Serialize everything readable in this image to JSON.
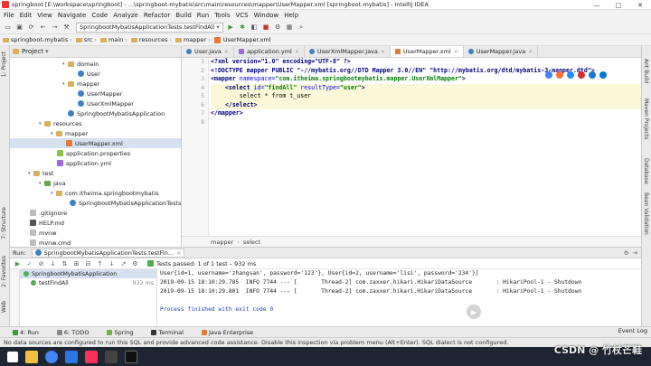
{
  "window": {
    "title": "springboot [E:\\workspace\\springboot] - ...\\springboot-mybatis\\src\\main\\resources\\mapper\\UserMapper.xml [springboot-mybatis] - IntelliJ IDEA",
    "controls": [
      "—",
      "□",
      "✕"
    ]
  },
  "menu": [
    "File",
    "Edit",
    "View",
    "Navigate",
    "Code",
    "Analyze",
    "Refactor",
    "Build",
    "Run",
    "Tools",
    "VCS",
    "Window",
    "Help"
  ],
  "toolbar": {
    "run_config": "SpringbootMybatisApplicationTests.testFindAll"
  },
  "breadcrumbs": [
    "springboot-mybatis",
    "src",
    "main",
    "resources",
    "mapper",
    "UserMapper.xml"
  ],
  "left_strip": [
    "1: Project",
    "7: Structure",
    "2: Favorites",
    "Web"
  ],
  "right_strip": [
    "Ant Build",
    "Maven Projects",
    "Database",
    "Bean Validation"
  ],
  "project_panel": {
    "title": "Project",
    "items": [
      {
        "label": "domain",
        "icon": "folder"
      },
      {
        "label": "User",
        "icon": "class"
      },
      {
        "label": "mapper",
        "icon": "folder"
      },
      {
        "label": "UserMapper",
        "icon": "class"
      },
      {
        "label": "UserXmlMapper",
        "icon": "class"
      },
      {
        "label": "SpringbootMybatisApplication",
        "icon": "class"
      },
      {
        "label": "resources",
        "icon": "folder"
      },
      {
        "label": "mapper",
        "icon": "folder"
      },
      {
        "label": "UserMapper.xml",
        "icon": "xml"
      },
      {
        "label": "application.properties",
        "icon": "props"
      },
      {
        "label": "application.yml",
        "icon": "yml"
      },
      {
        "label": "test",
        "icon": "folder"
      },
      {
        "label": "java",
        "icon": "greenfolder"
      },
      {
        "label": "com.itheima.springbootmybatis",
        "icon": "folder"
      },
      {
        "label": "SpringbootMybatisApplicationTests",
        "icon": "class"
      },
      {
        "label": ".gitignore",
        "icon": "file"
      },
      {
        "label": "HELP.md",
        "icon": "md"
      },
      {
        "label": "mvnw",
        "icon": "file"
      },
      {
        "label": "mvnw.cmd",
        "icon": "file"
      }
    ]
  },
  "editor": {
    "tabs": [
      "User.java",
      "application.yml",
      "UserXmlMapper.java",
      "UserMapper.xml",
      "UserMapper.java"
    ],
    "active_tab": "UserMapper.xml",
    "line_numbers": [
      "1",
      "2",
      "3",
      "4",
      "5",
      "6",
      "7",
      "8"
    ],
    "code": {
      "l1_a": "<?xml version=\"1.0\" encoding=\"UTF-8\" ?>",
      "l2_a": "<!DOCTYPE mapper PUBLIC \"-//mybatis.org//DTD Mapper 3.0//EN\" \"http://mybatis.org/dtd/mybatis-3-mapper.dtd\">",
      "l3_tag": "<mapper ",
      "l3_attr": "namespace=",
      "l3_str": "\"com.itheima.springbootmybatis.mapper.UserXmlMapper\"",
      "l3_end": ">",
      "l4_tag": "    <select ",
      "l4_attr1": "id=",
      "l4_str1": "\"findAll\"",
      "l4_attr2": " resultType=",
      "l4_str2": "\"user\"",
      "l4_end": ">",
      "l5": "        select * from t_user",
      "l6": "    </select>",
      "l7": "</mapper>"
    },
    "crumbs": [
      "mapper",
      "select"
    ]
  },
  "run_panel": {
    "label": "Run:",
    "tab": "SpringbootMybatisApplicationTests.testFin...",
    "status": "Tests passed: 1 of 1 test – 932 ms",
    "tests": [
      {
        "name": "SpringbootMybatisApplication",
        "time": ""
      },
      {
        "name": "testFindAll",
        "time": "932 ms"
      }
    ],
    "console": [
      "User{id=1, username='zhangsan', password='123'}, User{id=2, username='lisi', password='234'}]",
      "2019-09-15 18:10:29.785  INFO 7744 --- [       Thread-2] com.zaxxer.hikari.HikariDataSource       : HikariPool-1 - Shutdown",
      "2019-09-15 18:10:29.801  INFO 7744 --- [       Thread-2] com.zaxxer.hikari.HikariDataSource       : HikariPool-1 - Shutdown",
      "",
      "Process finished with exit code 0"
    ]
  },
  "bottom_tabs": [
    "4: Run",
    "6: TODO",
    "Spring",
    "Terminal",
    "Java Enterprise"
  ],
  "event_log": "Event Log",
  "statusbar": "No data sources are configured to run this SQL and provide advanced code assistance. Disable this inspection via problem menu (Alt+Enter). SQL dialect is not configured.",
  "watermark": "CSDN @ 竹杖芒鞋"
}
